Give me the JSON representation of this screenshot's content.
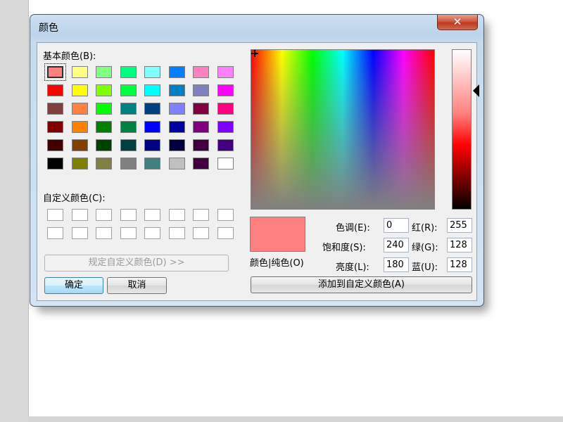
{
  "dialog": {
    "title": "颜色",
    "close_label": "✕",
    "basic_colors_label": "基本颜色(B):",
    "custom_colors_label": "自定义颜色(C):",
    "define_custom_button": "规定自定义颜色(D) >>",
    "ok_button": "确定",
    "cancel_button": "取消",
    "add_custom_button": "添加到自定义颜色(A)",
    "color_solid_label": "颜色|纯色(O)",
    "hue_label": "色调(E):",
    "saturation_label": "饱和度(S):",
    "luminance_label": "亮度(L):",
    "red_label": "红(R):",
    "green_label": "绿(G):",
    "blue_label": "蓝(U):",
    "hue_value": "0",
    "saturation_value": "240",
    "luminance_value": "180",
    "red_value": "255",
    "green_value": "128",
    "blue_value": "128"
  },
  "basic_colors": [
    [
      "#ff8080",
      "#ffff80",
      "#80ff80",
      "#00ff80",
      "#80ffff",
      "#0080ff",
      "#ff80c0",
      "#ff80ff"
    ],
    [
      "#ff0000",
      "#ffff00",
      "#80ff00",
      "#00ff40",
      "#00ffff",
      "#0080c0",
      "#8080c0",
      "#ff00ff"
    ],
    [
      "#804040",
      "#ff8040",
      "#00ff00",
      "#008080",
      "#004080",
      "#8080ff",
      "#800040",
      "#ff0080"
    ],
    [
      "#800000",
      "#ff8000",
      "#008000",
      "#008040",
      "#0000ff",
      "#0000a0",
      "#800080",
      "#8000ff"
    ],
    [
      "#400000",
      "#804000",
      "#004000",
      "#004040",
      "#000080",
      "#000040",
      "#400040",
      "#400080"
    ],
    [
      "#000000",
      "#808000",
      "#808040",
      "#808080",
      "#408080",
      "#c0c0c0",
      "#400040",
      "#ffffff"
    ]
  ],
  "selected_color": "#ff8080"
}
